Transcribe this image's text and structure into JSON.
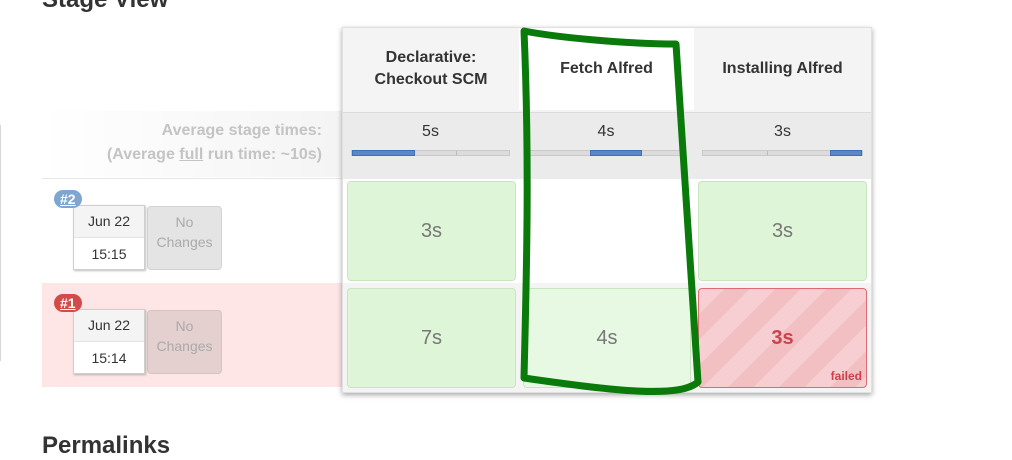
{
  "sections": {
    "stage_view_title": "Stage View",
    "permalinks_title": "Permalinks"
  },
  "stages": [
    {
      "name_line1": "Declarative:",
      "name_line2": "Checkout SCM",
      "avg_time": "5s",
      "avg_progress": 0.47
    },
    {
      "name_line1": "Fetch Alfred",
      "name_line2": "",
      "avg_time": "4s",
      "avg_progress": 0.73
    },
    {
      "name_line1": "Installing Alfred",
      "name_line2": "",
      "avg_time": "3s",
      "avg_progress": 1.0
    }
  ],
  "average": {
    "line1": "Average stage times:",
    "line2_prefix": "(Average ",
    "line2_link": "full",
    "line2_suffix": " run time: ~10s)"
  },
  "runs": [
    {
      "badge": "#2",
      "badge_color": "#7fa5d1",
      "date": "Jun 22",
      "time": "15:15",
      "changes_line1": "No",
      "changes_line2": "Changes",
      "cells": [
        "3s",
        "",
        "3s"
      ]
    },
    {
      "badge": "#1",
      "badge_color": "#d24b4b",
      "date": "Jun 22",
      "time": "15:14",
      "changes_line1": "No",
      "changes_line2": "Changes",
      "cells": [
        "7s",
        "4s",
        "3s"
      ],
      "failed_label": "failed"
    }
  ],
  "colors": {
    "success": "#dff5d8",
    "failed": "#f7cfd2",
    "annotation": "#0a7a0a"
  }
}
